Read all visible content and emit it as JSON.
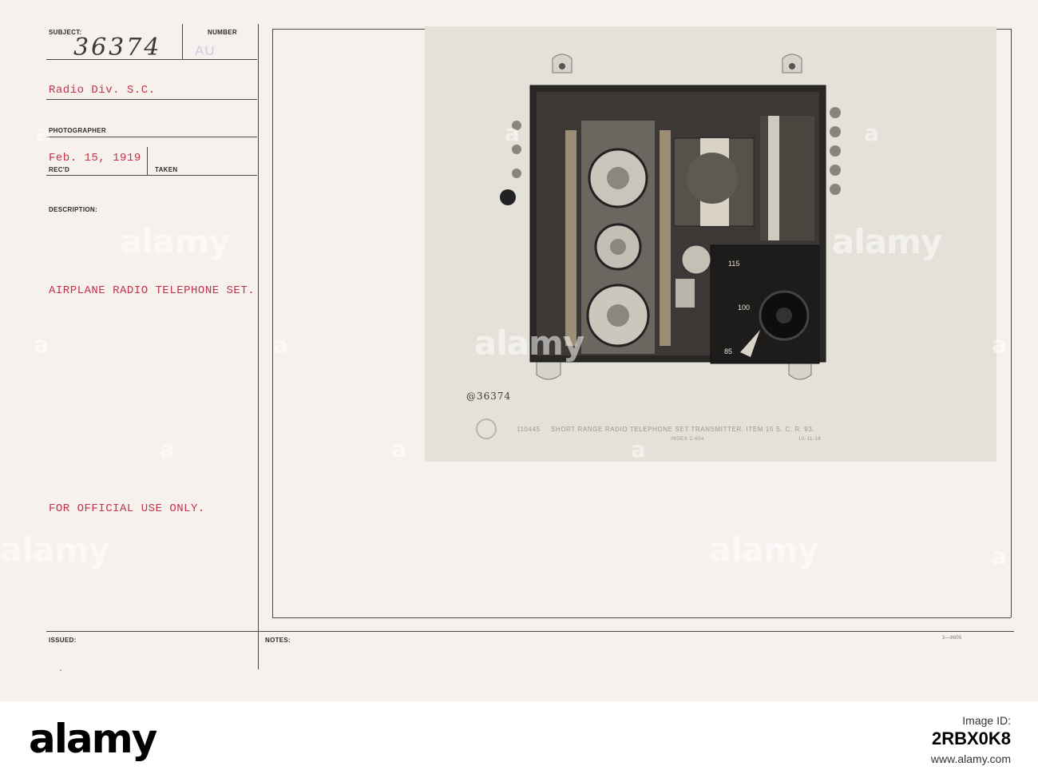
{
  "form": {
    "subject_label": "SUBJECT:",
    "number_label": "NUMBER",
    "subject_number": "36374",
    "stamp_code": "AU",
    "subject_text": "Radio Div. S.C.",
    "photographer_label": "PHOTOGRAPHER",
    "date": "Feb. 15, 1919",
    "recd_label": "REC'D",
    "taken_label": "TAKEN",
    "description_label": "DESCRIPTION:",
    "description": "AIRPLANE RADIO TELEPHONE SET.",
    "official_note": "FOR OFFICIAL USE ONLY.",
    "issued_label": "ISSUED:",
    "notes_label": "NOTES:",
    "form_code": "3—9605"
  },
  "photo": {
    "handwritten_number": "@36374",
    "caption_number": "110445",
    "caption_text": "SHORT RANGE RADIO TELEPHONE SET TRANSMITTER. ITEM 15 S. C. R. 93.",
    "caption_index": "INDEX 2-654",
    "caption_date": "10-11-18",
    "dial_marks": [
      "85",
      "100",
      "115"
    ]
  },
  "watermark": {
    "text": "alamy",
    "small_text": "a"
  },
  "footer": {
    "brand": "alamy",
    "id_label": "Image ID:",
    "id_value": "2RBX0K8",
    "site": "www.alamy.com"
  },
  "colors": {
    "card_bg": "#f7f1ee",
    "typed_red": "#c0344a",
    "rule": "#4a4a4a"
  }
}
